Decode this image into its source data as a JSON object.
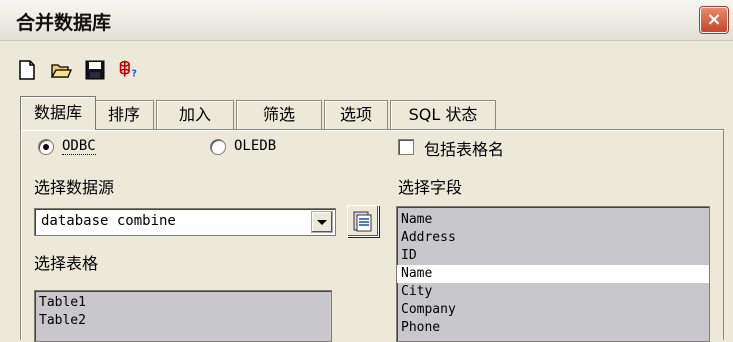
{
  "window": {
    "title": "合并数据库",
    "close_label": "×"
  },
  "toolbar": {
    "icons": [
      "new-document-icon",
      "open-folder-icon",
      "save-floppy-icon",
      "help-query-icon"
    ]
  },
  "tabs": [
    {
      "label": "数据库"
    },
    {
      "label": "排序"
    },
    {
      "label": "加入"
    },
    {
      "label": "筛选"
    },
    {
      "label": "选项"
    },
    {
      "label": "SQL 状态"
    }
  ],
  "source": {
    "odbc_label": "ODBC",
    "oledb_label": "OLEDB",
    "selected": "ODBC",
    "include_table_names_label": "包括表格名",
    "select_source_label": "选择数据源",
    "datasource_value": "database combine",
    "select_table_label": "选择表格",
    "tables": [
      "Table1",
      "Table2"
    ],
    "select_fields_label": "选择字段",
    "fields": [
      "Name",
      "Address",
      "ID",
      "Name",
      "City",
      "Company",
      "Phone"
    ],
    "selected_field_index": 3
  }
}
